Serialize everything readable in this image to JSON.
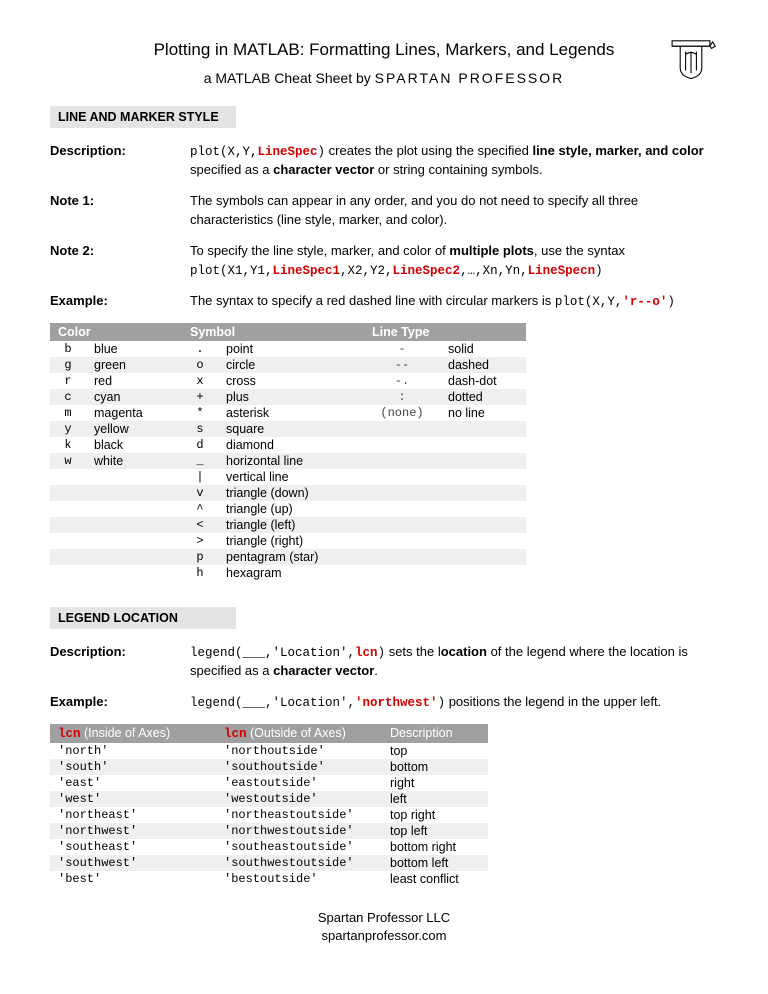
{
  "title": "Plotting in MATLAB: Formatting Lines, Markers, and Legends",
  "subtitle_prefix": "a MATLAB Cheat Sheet by ",
  "subtitle_brand": "SPARTAN PROFESSOR",
  "section1": {
    "header": "LINE AND MARKER STYLE",
    "description_label": "Description:",
    "description_code1": "plot(X,Y,",
    "description_code_red": "LineSpec",
    "description_code2": ")",
    "description_text1": " creates the plot using the specified ",
    "description_bold1": "line style, marker, and color",
    "description_text2": " specified as a ",
    "description_bold2": "character vector",
    "description_text3": " or string containing symbols.",
    "note1_label": "Note 1:",
    "note1_text": "The symbols can appear in any order, and you do not need to specify all three characteristics (line style, marker, and color).",
    "note2_label": "Note 2:",
    "note2_text1": "To specify the line style, marker, and color of ",
    "note2_bold": "multiple plots",
    "note2_text2": ", use the syntax",
    "note2_code_p1": "plot(X1,Y1,",
    "note2_code_r1": "LineSpec1",
    "note2_code_p2": ",X2,Y2,",
    "note2_code_r2": "LineSpec2",
    "note2_code_p3": ",…,Xn,Yn,",
    "note2_code_r3": "LineSpecn",
    "note2_code_p4": ")",
    "example_label": "Example:",
    "example_text": "The syntax to specify a red dashed line with circular markers is ",
    "example_code1": "plot(X,Y,",
    "example_code_red": "'r--o'",
    "example_code2": ")",
    "headers": [
      "Color",
      "Symbol",
      "Line Type"
    ],
    "rows": [
      {
        "cc": "b",
        "cn": "blue",
        "sc": ".",
        "sn": "point",
        "lc": "-",
        "ln": "solid"
      },
      {
        "cc": "g",
        "cn": "green",
        "sc": "o",
        "sn": "circle",
        "lc": "--",
        "ln": "dashed"
      },
      {
        "cc": "r",
        "cn": "red",
        "sc": "x",
        "sn": "cross",
        "lc": "-.",
        "ln": "dash-dot"
      },
      {
        "cc": "c",
        "cn": "cyan",
        "sc": "+",
        "sn": "plus",
        "lc": ":",
        "ln": "dotted"
      },
      {
        "cc": "m",
        "cn": "magenta",
        "sc": "*",
        "sn": "asterisk",
        "lc": "(none)",
        "ln": "no line"
      },
      {
        "cc": "y",
        "cn": "yellow",
        "sc": "s",
        "sn": "square",
        "lc": "",
        "ln": ""
      },
      {
        "cc": "k",
        "cn": "black",
        "sc": "d",
        "sn": "diamond",
        "lc": "",
        "ln": ""
      },
      {
        "cc": "w",
        "cn": "white",
        "sc": "_",
        "sn": "horizontal line",
        "lc": "",
        "ln": ""
      },
      {
        "cc": "",
        "cn": "",
        "sc": "|",
        "sn": "vertical line",
        "lc": "",
        "ln": ""
      },
      {
        "cc": "",
        "cn": "",
        "sc": "v",
        "sn": "triangle (down)",
        "lc": "",
        "ln": ""
      },
      {
        "cc": "",
        "cn": "",
        "sc": "^",
        "sn": "triangle (up)",
        "lc": "",
        "ln": ""
      },
      {
        "cc": "",
        "cn": "",
        "sc": "<",
        "sn": "triangle (left)",
        "lc": "",
        "ln": ""
      },
      {
        "cc": "",
        "cn": "",
        "sc": ">",
        "sn": "triangle (right)",
        "lc": "",
        "ln": ""
      },
      {
        "cc": "",
        "cn": "",
        "sc": "p",
        "sn": "pentagram (star)",
        "lc": "",
        "ln": ""
      },
      {
        "cc": "",
        "cn": "",
        "sc": "h",
        "sn": "hexagram",
        "lc": "",
        "ln": ""
      }
    ]
  },
  "section2": {
    "header": "LEGEND LOCATION",
    "description_label": "Description:",
    "desc_code1": "legend(___,",
    "desc_code2": "'Location'",
    "desc_code3": ",",
    "desc_code_red": "lcn",
    "desc_code4": ")",
    "desc_text1": " sets the l",
    "desc_bold": "ocation",
    "desc_text2": " of the legend where the location is specified as a ",
    "desc_bold2": "character vector",
    "desc_text3": ".",
    "example_label": "Example:",
    "ex_code1": "legend(___,",
    "ex_code2": "'Location'",
    "ex_code3": ",",
    "ex_code_red": "'northwest'",
    "ex_code4": ")",
    "ex_text": " positions the legend in the upper left.",
    "h_lcn": "lcn",
    "h_inside": " (Inside of Axes)",
    "h_outside": " (Outside of Axes)",
    "h_desc": "Description",
    "rows": [
      {
        "in": "'north'",
        "out": "'northoutside'",
        "d": "top"
      },
      {
        "in": "'south'",
        "out": "'southoutside'",
        "d": "bottom"
      },
      {
        "in": "'east'",
        "out": "'eastoutside'",
        "d": "right"
      },
      {
        "in": "'west'",
        "out": "'westoutside'",
        "d": "left"
      },
      {
        "in": "'northeast'",
        "out": "'northeastoutside'",
        "d": "top right"
      },
      {
        "in": "'northwest'",
        "out": "'northwestoutside'",
        "d": "top left"
      },
      {
        "in": "'southeast'",
        "out": "'southeastoutside'",
        "d": "bottom right"
      },
      {
        "in": "'southwest'",
        "out": "'southwestoutside'",
        "d": "bottom left"
      },
      {
        "in": "'best'",
        "out": "'bestoutside'",
        "d": "least conflict"
      }
    ]
  },
  "footer": {
    "line1": "Spartan Professor LLC",
    "line2": "spartanprofessor.com"
  }
}
